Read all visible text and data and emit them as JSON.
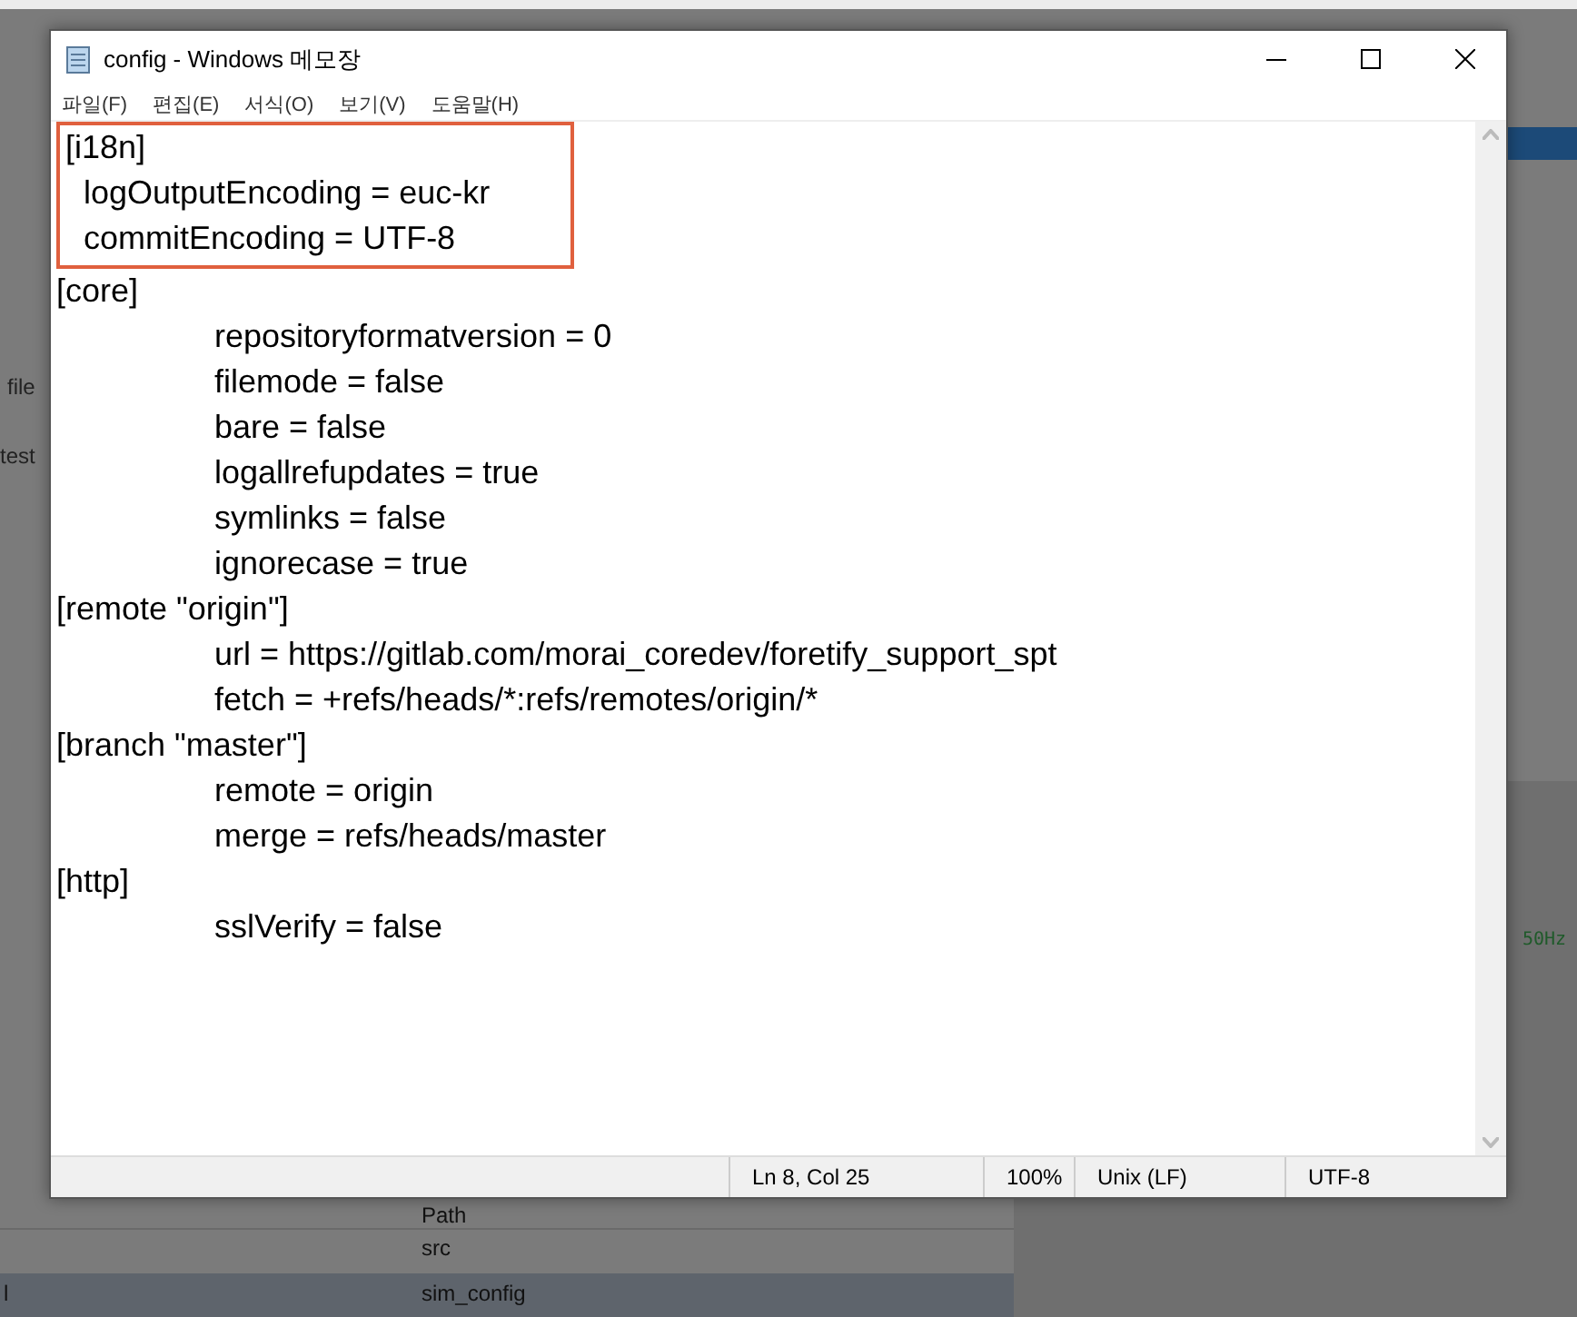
{
  "background_app": {
    "left_fragments": [
      "file",
      "test"
    ],
    "file_table": {
      "header": "Path",
      "rows": [
        {
          "column_1": "",
          "path": "src",
          "selected": false
        },
        {
          "column_1": "l",
          "path": "sim_config",
          "selected": true
        }
      ]
    },
    "code_fragments": [
      "50Hz"
    ]
  },
  "notepad": {
    "title": "config - Windows 메모장",
    "menu": [
      "파일(F)",
      "편집(E)",
      "서식(O)",
      "보기(V)",
      "도움말(H)"
    ],
    "lines": [
      {
        "text": "[i18n]",
        "highlighted": true
      },
      {
        "text": "  logOutputEncoding = euc-kr",
        "highlighted": true
      },
      {
        "text": "  commitEncoding = UTF-8",
        "highlighted": true
      },
      {
        "text": "[core]",
        "highlighted": false
      },
      {
        "text": "\trepositoryformatversion = 0",
        "highlighted": false
      },
      {
        "text": "\tfilemode = false",
        "highlighted": false
      },
      {
        "text": "\tbare = false",
        "highlighted": false
      },
      {
        "text": "\tlogallrefupdates = true",
        "highlighted": false
      },
      {
        "text": "\tsymlinks = false",
        "highlighted": false
      },
      {
        "text": "\tignorecase = true",
        "highlighted": false
      },
      {
        "text": "[remote \"origin\"]",
        "highlighted": false
      },
      {
        "text": "\turl = https://gitlab.com/morai_coredev/foretify_support_spt",
        "highlighted": false
      },
      {
        "text": "\tfetch = +refs/heads/*:refs/remotes/origin/*",
        "highlighted": false
      },
      {
        "text": "[branch \"master\"]",
        "highlighted": false
      },
      {
        "text": "\tremote = origin",
        "highlighted": false
      },
      {
        "text": "\tmerge = refs/heads/master",
        "highlighted": false
      },
      {
        "text": "[http]",
        "highlighted": false
      },
      {
        "text": "\tsslVerify = false",
        "highlighted": false
      }
    ],
    "status_bar": {
      "position": "Ln 8, Col 25",
      "zoom": "100%",
      "line_ending": "Unix (LF)",
      "encoding": "UTF-8"
    }
  }
}
